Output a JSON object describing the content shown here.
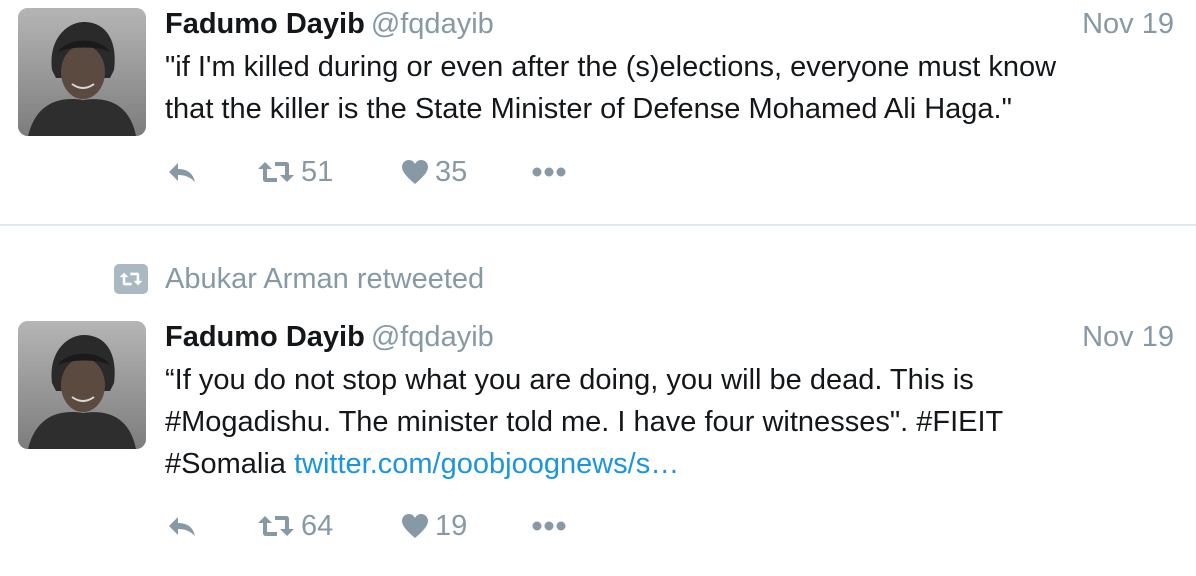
{
  "tweets": [
    {
      "author_name": "Fadumo Dayib",
      "author_handle": "@fqdayib",
      "date": "Nov 19",
      "text_lines": [
        "\"if I'm killed during or even after the (s)elections, everyone must know",
        "that the killer is the State Minister of Defense Mohamed Ali Haga.\""
      ],
      "retweet_count": "51",
      "like_count": "35"
    },
    {
      "retweeted_by": "Abukar Arman retweeted",
      "author_name": "Fadumo Dayib",
      "author_handle": "@fqdayib",
      "date": "Nov 19",
      "text_lines": [
        "“If you do not stop what you are doing, you will be dead. This is",
        "#Mogadishu. The minister told me. I have four witnesses\". #FIEIT"
      ],
      "text_line3_prefix": "#Somalia",
      "text_link": "twitter.com/goobjoognews/s…",
      "retweet_count": "64",
      "like_count": "19"
    }
  ],
  "icons": {
    "reply": "reply-icon",
    "retweet": "retweet-icon",
    "like": "heart-icon",
    "more": "more-icon",
    "avatar": "avatar-photo"
  },
  "colors": {
    "text": "#14171a",
    "muted": "#8899a6",
    "link": "#1b95e0",
    "divider": "#e1e8ed"
  }
}
